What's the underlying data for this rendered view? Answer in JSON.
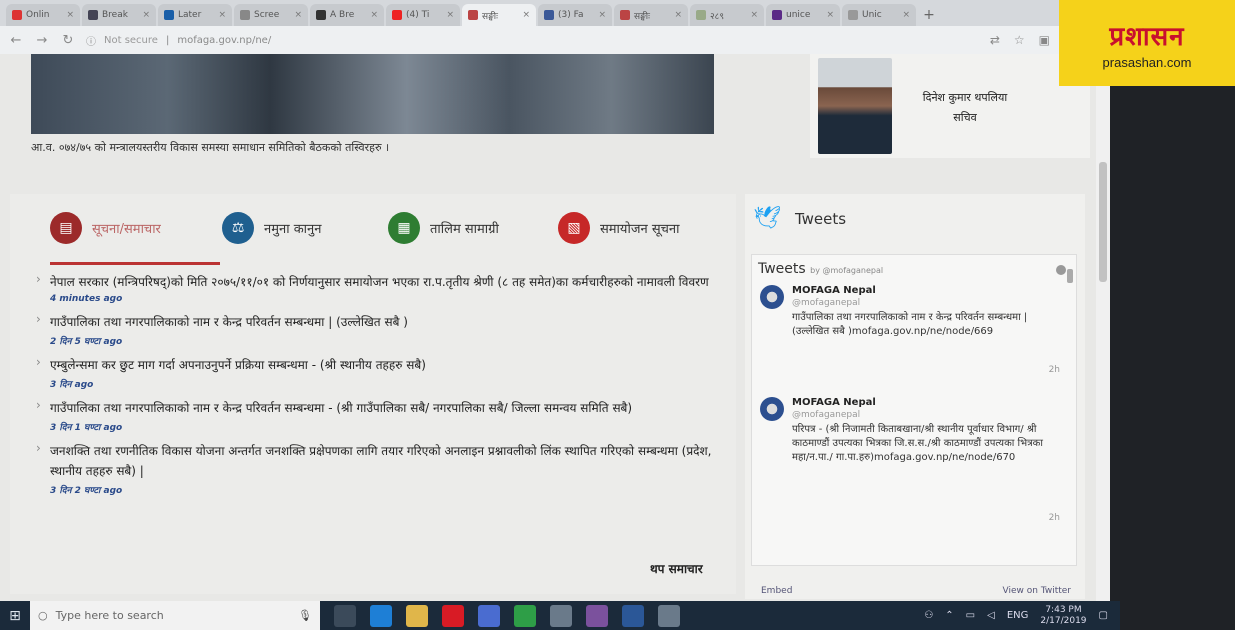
{
  "browser": {
    "tabs": [
      {
        "label": "Onlin",
        "color": "#d33"
      },
      {
        "label": "Break",
        "color": "#445"
      },
      {
        "label": "Later",
        "color": "#1a5fa8"
      },
      {
        "label": "Scree",
        "color": "#888"
      },
      {
        "label": "A Bre",
        "color": "#333"
      },
      {
        "label": "(4) Ti",
        "color": "#e22"
      },
      {
        "label": "सङ्घीः",
        "color": "#b44",
        "active": true
      },
      {
        "label": "(3) Fa",
        "color": "#3b5998"
      },
      {
        "label": "सङ्घीः",
        "color": "#b44"
      },
      {
        "label": "२८९",
        "color": "#9a8"
      },
      {
        "label": "unice",
        "color": "#5b2a86"
      },
      {
        "label": "Unic",
        "color": "#999"
      }
    ],
    "new_tab": "+",
    "security_label": "Not secure",
    "url": "mofaga.gov.np/ne/"
  },
  "banner": {
    "caption": "आ.व. ०७४/७५ को मन्त्रालयस्तरीय विकास समस्या समाधान समितिको बैठकको तस्विरहरु ।",
    "person_name": "दिनेश कुमार थपलिया",
    "person_title": "सचिव"
  },
  "news": {
    "tabs": [
      {
        "label": "सूचना/समाचार",
        "icon": "news-icon",
        "color": "#9c2a2a"
      },
      {
        "label": "नमुना कानुन",
        "icon": "scales-icon",
        "color": "#1f5f8f"
      },
      {
        "label": "तालिम सामाग्री",
        "icon": "training-icon",
        "color": "#2e7d32"
      },
      {
        "label": "समायोजन सूचना",
        "icon": "document-icon",
        "color": "#c62828"
      }
    ],
    "items": [
      {
        "text": "नेपाल सरकार (मन्त्रिपरिषद्)को मिति २०७५/११/०१ को निर्णयानुसार समायोजन भएका रा.प.तृतीय श्रेणी (८ तह समेत)का कर्मचारीहरुको नामावली विवरण",
        "time": "4 minutes ago"
      },
      {
        "text": "गाउँपालिका तथा नगरपालिकाको नाम र केन्द्र परिवर्तन सम्बन्धमा | (उल्लेखित सबै )",
        "time": "2 दिन 5 घण्टा ago"
      },
      {
        "text": "एम्बुलेन्समा कर छुट माग गर्दा अपनाउनुपर्ने प्रक्रिया सम्बन्धमा - (श्री स्थानीय तहहरु सबै)",
        "time": "3 दिन ago"
      },
      {
        "text": "गाउँपालिका तथा नगरपालिकाको नाम र केन्द्र परिवर्तन सम्बन्धमा - (श्री गाउँपालिका सबै/ नगरपालिका सबै/ जिल्ला समन्वय समिति सबै)",
        "time": "3 दिन 1 घण्टा ago"
      },
      {
        "text": "जनशक्ति तथा रणनीतिक विकास योजना अन्तर्गत जनशक्ति प्रक्षेपणका लागि तयार गरिएको अनलाइन प्रश्नावलीको लिंक स्थापित गरिएको सम्बन्धमा (प्रदेश, स्थानीय तहहरु सबै) |",
        "time": "3 दिन 2 घण्टा ago"
      }
    ],
    "more_label": "थप समाचार"
  },
  "tweets": {
    "heading": "Tweets",
    "widget_title": "Tweets",
    "widget_by": "by @mofaganepal",
    "items": [
      {
        "name": "MOFAGA Nepal",
        "handle": "@mofaganepal",
        "text": "गाउँपालिका तथा नगरपालिकाको नाम र केन्द्र परिवर्तन सम्बन्धमा | (उल्लेखित सबै )mofaga.gov.np/ne/node/669",
        "age": "2h"
      },
      {
        "name": "MOFAGA Nepal",
        "handle": "@mofaganepal",
        "text": "परिपत्र - (श्री निजामती किताबखाना/श्री स्थानीय पूर्वाधार विभाग/ श्री काठमाण्डौं उपत्यका भित्रका जि.स.स./श्री काठमाण्डौं उपत्यका भित्रका महा/न.पा./ गा.पा.हरु)mofaga.gov.np/ne/node/670",
        "age": "2h"
      }
    ],
    "embed_label": "Embed",
    "view_label": "View on Twitter"
  },
  "taskbar": {
    "search_placeholder": "Type here to search",
    "apps": [
      {
        "icon": "task-view-icon",
        "color": "#3b4a5a"
      },
      {
        "icon": "edge-icon",
        "color": "#1e7fd6"
      },
      {
        "icon": "explorer-icon",
        "color": "#e0b64a"
      },
      {
        "icon": "opera-icon",
        "color": "#d81b25"
      },
      {
        "icon": "store-icon",
        "color": "#4a6cd0"
      },
      {
        "icon": "chrome-icon",
        "color": "#2e9e47"
      },
      {
        "icon": "mail-icon",
        "color": "#6a7a8a"
      },
      {
        "icon": "viber-icon",
        "color": "#7b519d"
      },
      {
        "icon": "word-icon",
        "color": "#2b5797"
      },
      {
        "icon": "app-icon",
        "color": "#6a7a8a"
      }
    ],
    "lang": "ENG",
    "time": "7:43 PM",
    "date": "2/17/2019"
  },
  "logo": {
    "devanagari": "प्रशासन",
    "latin": "prasashan.com"
  }
}
